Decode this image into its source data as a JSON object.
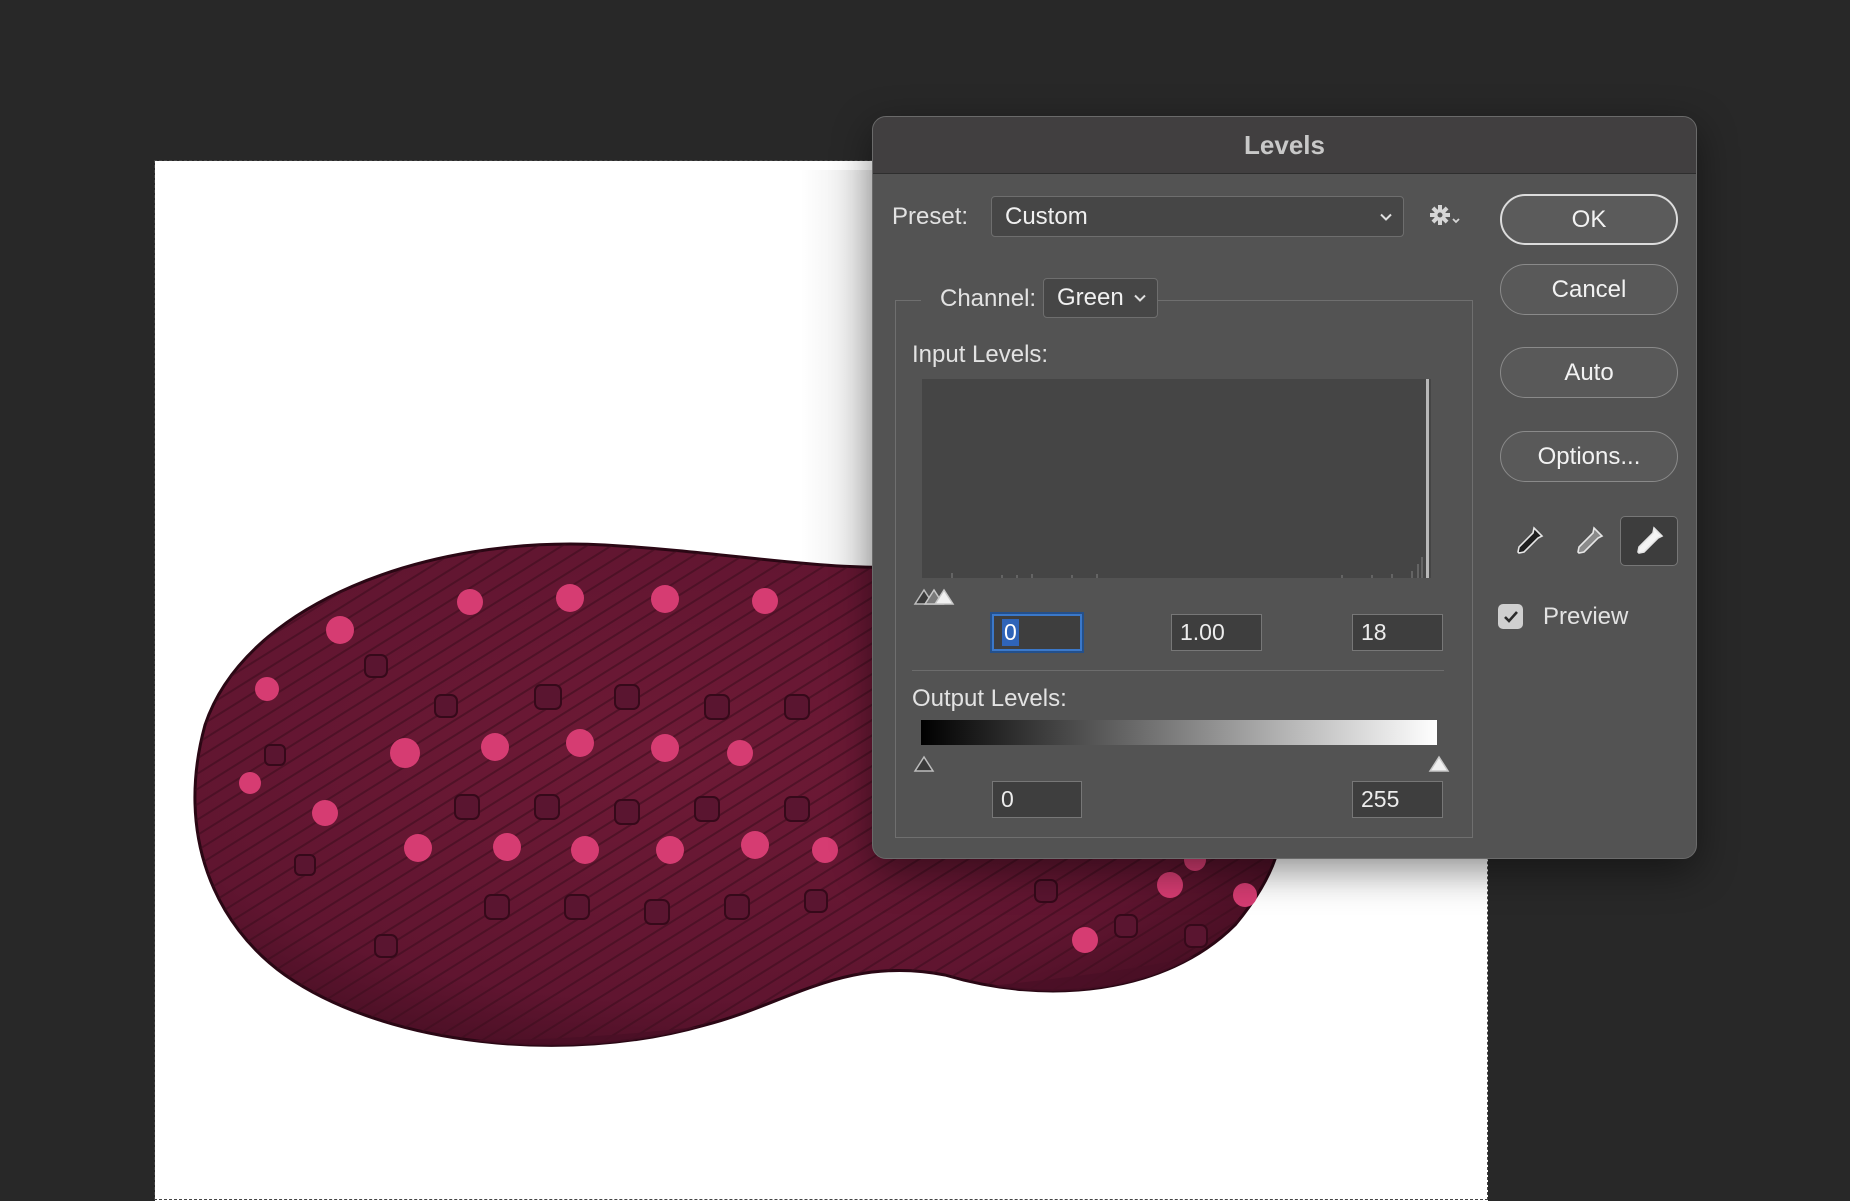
{
  "dialog": {
    "title": "Levels",
    "preset_label": "Preset:",
    "preset_value": "Custom",
    "channel_label": "Channel:",
    "channel_value": "Green",
    "input_levels_label": "Input Levels:",
    "input_black": "0",
    "input_gamma": "1.00",
    "input_white": "18",
    "output_levels_label": "Output Levels:",
    "output_black": "0",
    "output_white": "255",
    "buttons": {
      "ok": "OK",
      "cancel": "Cancel",
      "auto": "Auto",
      "options": "Options..."
    },
    "preview_label": "Preview",
    "preview_checked": true,
    "eyedroppers": [
      "black-point-eyedropper-icon",
      "gray-point-eyedropper-icon",
      "white-point-eyedropper-icon"
    ],
    "selected_eyedropper": "white"
  },
  "colors": {
    "canvas_bg": "#282828",
    "dialog_bg": "#535353",
    "titlebar_bg": "#413f40",
    "focus_blue": "#3b78c9",
    "sole_base": "#7a1d3c",
    "sole_dots": "#e2427a"
  }
}
